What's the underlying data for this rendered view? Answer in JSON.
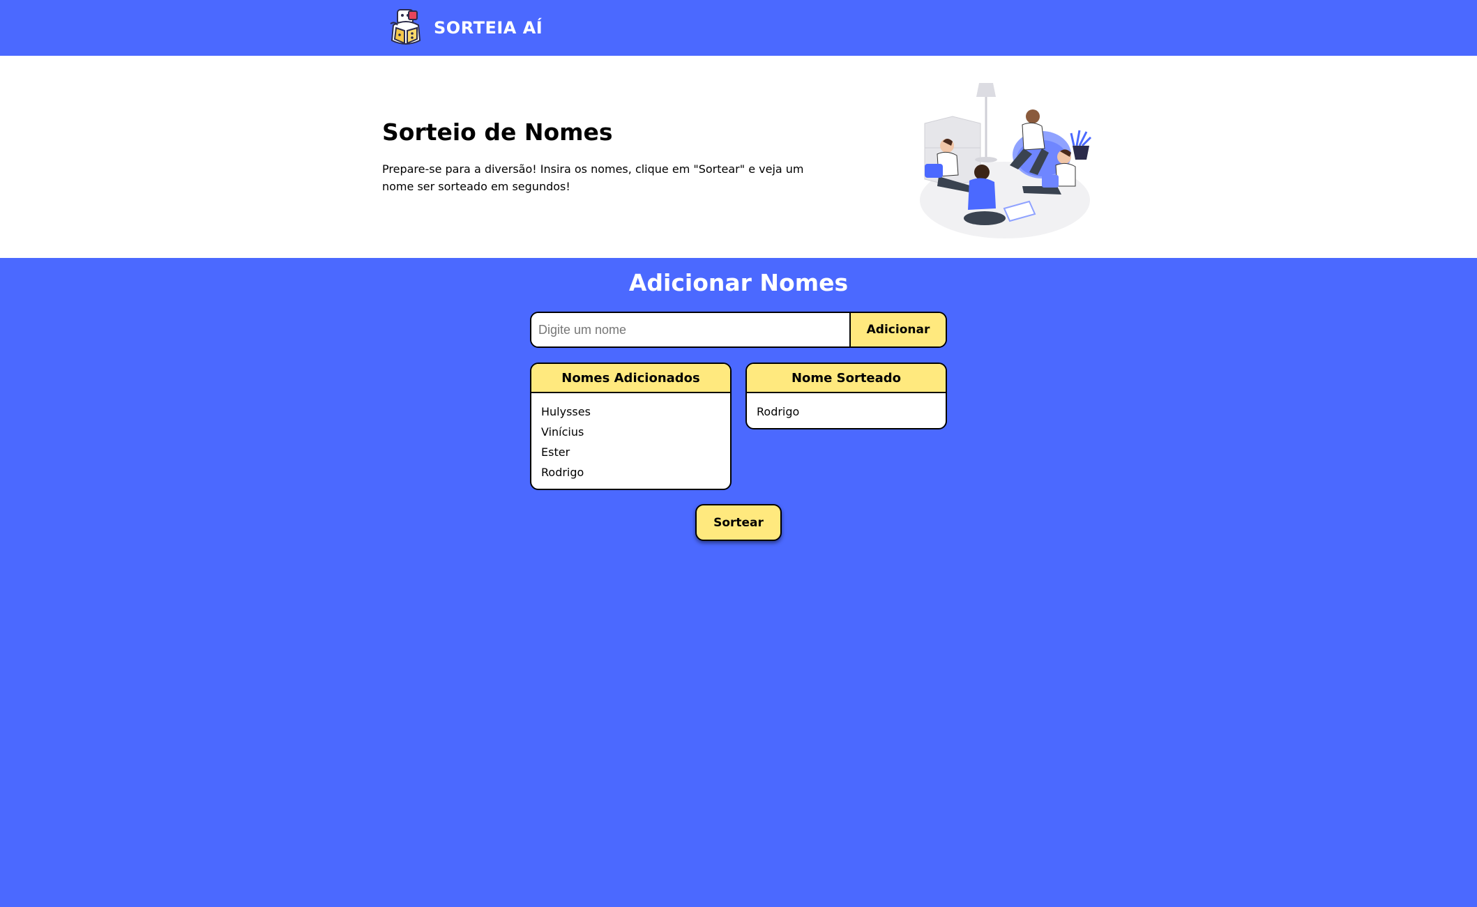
{
  "header": {
    "brand_name": "SORTEIA AÍ",
    "logo_icon": "dice-mascot-logo-icon"
  },
  "hero": {
    "title": "Sorteio de Nomes",
    "description": "Prepare-se para a diversão! Insira os nomes, clique em \"Sortear\" e veja um nome ser sorteado em segundos!",
    "illustration": "friends-hanging-out-illustration"
  },
  "add_section": {
    "title": "Adicionar Nomes",
    "input_value": "",
    "input_placeholder": "Digite um nome",
    "add_button_label": "Adicionar"
  },
  "added_names": {
    "title": "Nomes Adicionados",
    "items": [
      "Hulysses",
      "Vinícius",
      "Ester",
      "Rodrigo"
    ]
  },
  "drawn_name": {
    "title": "Nome Sorteado",
    "items": [
      "Rodrigo"
    ]
  },
  "draw_button_label": "Sortear",
  "colors": {
    "primary_blue": "#4b69ff",
    "accent_yellow": "#ffe97e",
    "white": "#ffffff",
    "border_black": "#000000"
  }
}
